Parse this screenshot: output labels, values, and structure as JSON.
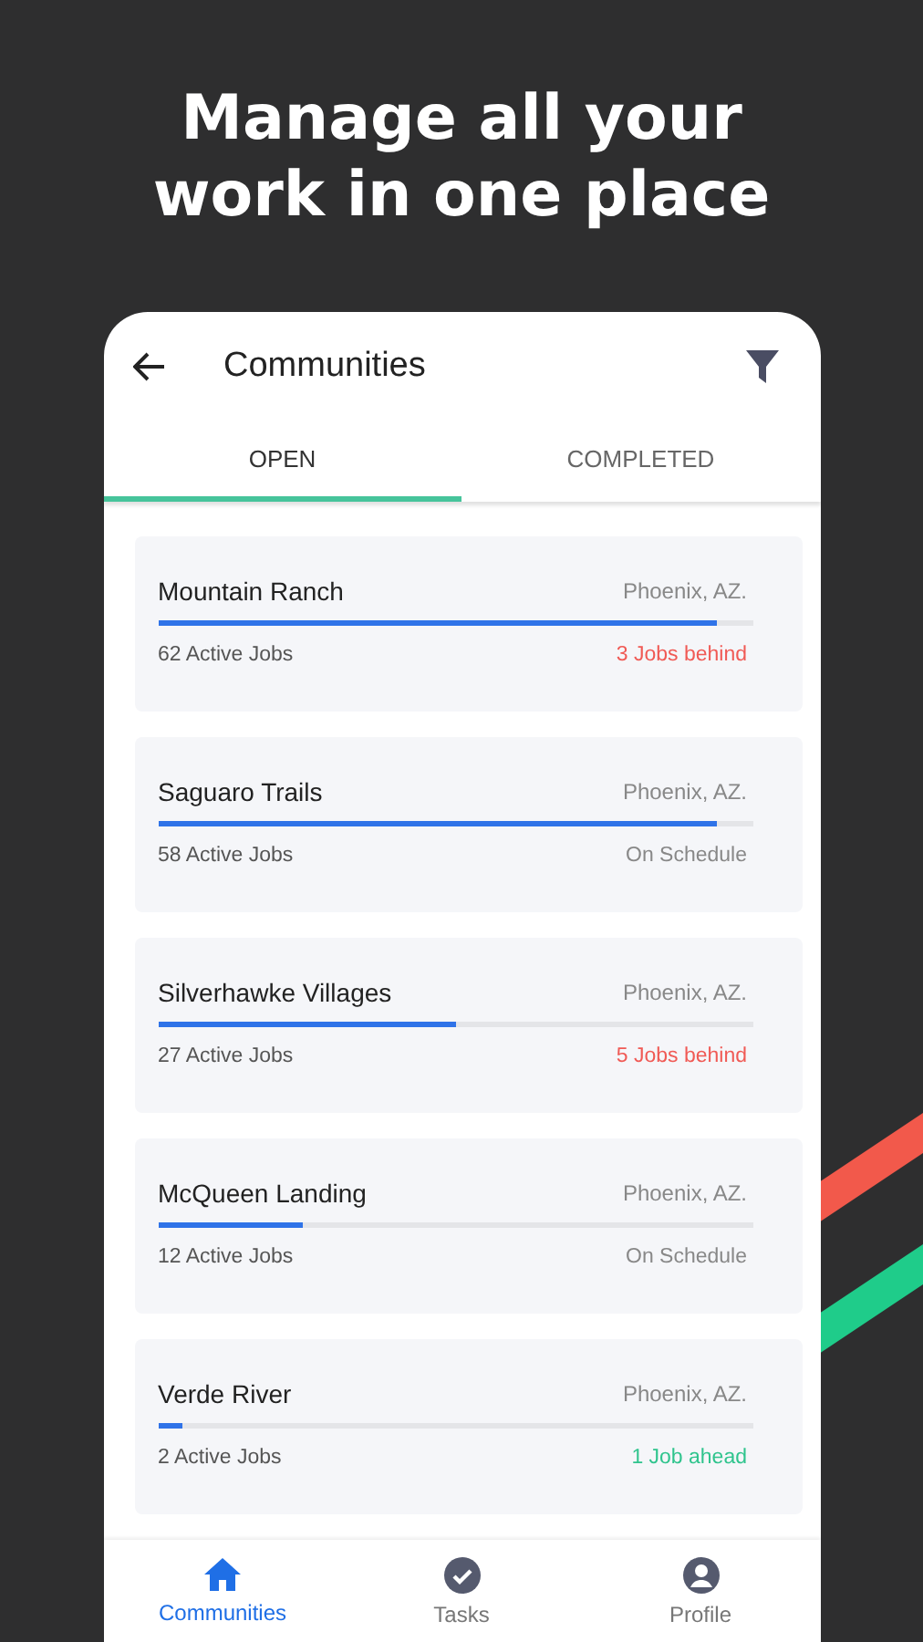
{
  "headline": "Manage all your work in one place",
  "app_bar": {
    "title": "Communities"
  },
  "tabs": [
    {
      "label": "OPEN",
      "selected": true
    },
    {
      "label": "COMPLETED",
      "selected": false
    }
  ],
  "communities": [
    {
      "name": "Mountain Ranch",
      "location": "Phoenix, AZ.",
      "level": 0.94,
      "jobs": "62 Active Jobs",
      "status": "3 Jobs behind",
      "kind": "behind"
    },
    {
      "name": "Saguaro Trails",
      "location": "Phoenix, AZ.",
      "level": 0.94,
      "jobs": "58 Active Jobs",
      "status": "On Schedule",
      "kind": "on_schedule"
    },
    {
      "name": "Silverhawke Villages",
      "location": "Phoenix, AZ.",
      "level": 0.5,
      "jobs": "27 Active Jobs",
      "status": "5 Jobs behind",
      "kind": "behind"
    },
    {
      "name": "McQueen Landing",
      "location": "Phoenix, AZ.",
      "level": 0.245,
      "jobs": "12 Active Jobs",
      "status": "On Schedule",
      "kind": "on_schedule"
    },
    {
      "name": "Verde River",
      "location": "Phoenix, AZ.",
      "level": 0.04,
      "jobs": "2 Active Jobs",
      "status": "1 Job ahead",
      "kind": "ahead"
    }
  ],
  "bottom_nav": [
    {
      "label": "Communities",
      "selected": true
    },
    {
      "label": "Tasks",
      "selected": false
    },
    {
      "label": "Profile",
      "selected": false
    }
  ]
}
